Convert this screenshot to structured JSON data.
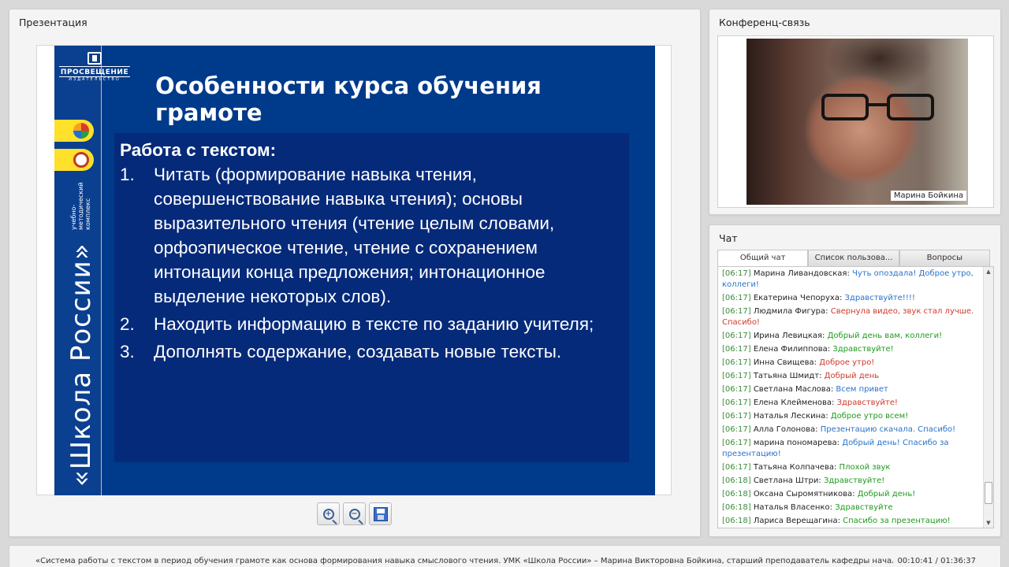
{
  "presentation": {
    "title": "Презентация",
    "slide": {
      "logo_text": "ПРОСВЕЩЕНИЕ",
      "logo_sub": "ИЗДАТЕЛЬСТВО",
      "side_big": "«Школа России»",
      "side_small": "учебно-методический комплекс",
      "title": "Особенности курса обучения грамоте",
      "heading": "Работа с текстом:",
      "items": [
        {
          "num": "1.",
          "text": "Читать (формирование навыка чтения, совершенствование навыка чтения); основы выразительного чтения (чтение целым словами, орфоэпическое чтение, чтение с сохранением интонации конца предложения; интонационное выделение некоторых слов)."
        },
        {
          "num": "2.",
          "text": "Находить информацию в тексте по заданию учителя;"
        },
        {
          "num": "3.",
          "text": "Дополнять содержание,  создавать новые тексты."
        }
      ]
    },
    "toolbar": {
      "zoom_in_icon": "zoom-in-icon",
      "zoom_out_icon": "zoom-out-icon",
      "save_icon": "save-icon"
    }
  },
  "conference": {
    "title": "Конференц-связь",
    "video_label": "Марина Бойкина"
  },
  "chat": {
    "title": "Чат",
    "tabs": [
      "Общий чат",
      "Список пользова...",
      "Вопросы"
    ],
    "messages": [
      {
        "time": "[06:17]",
        "author": "Марина Ливандовская:",
        "text": "Чуть опоздала! Доброе утро, коллеги!",
        "color": "blue"
      },
      {
        "time": "[06:17]",
        "author": "Екатерина Чепоруха:",
        "text": "Здравствуйте!!!!",
        "color": "blue"
      },
      {
        "time": "[06:17]",
        "author": "Людмила Фигура:",
        "text": "Свернула видео, звук стал лучше. Спасибо!",
        "color": "red"
      },
      {
        "time": "[06:17]",
        "author": "Ирина Левицкая:",
        "text": "Добрый день вам, коллеги!",
        "color": "green"
      },
      {
        "time": "[06:17]",
        "author": "Елена Филиппова:",
        "text": "Здравствуйте!",
        "color": "green"
      },
      {
        "time": "[06:17]",
        "author": "Инна Свищева:",
        "text": "Доброе утро!",
        "color": "red"
      },
      {
        "time": "[06:17]",
        "author": "Татьяна Шмидт:",
        "text": "Добрый день",
        "color": "red"
      },
      {
        "time": "[06:17]",
        "author": "Светлана Маслова:",
        "text": "Всем привет",
        "color": "blue"
      },
      {
        "time": "[06:17]",
        "author": "Елена Клейменова:",
        "text": "Здравствуйте!",
        "color": "red"
      },
      {
        "time": "[06:17]",
        "author": "Наталья Лескина:",
        "text": "Доброе утро всем!",
        "color": "green"
      },
      {
        "time": "[06:17]",
        "author": "Алла Голонова:",
        "text": "Презентацию скачала. Спасибо!",
        "color": "blue"
      },
      {
        "time": "[06:17]",
        "author": "марина пономарева:",
        "text": "Добрый день! Спасибо за презентацию!",
        "color": "blue"
      },
      {
        "time": "[06:17]",
        "author": "Татьяна Колпачева:",
        "text": "Плохой звук",
        "color": "green"
      },
      {
        "time": "[06:18]",
        "author": "Светлана Штри:",
        "text": "Здравствуйте!",
        "color": "green"
      },
      {
        "time": "[06:18]",
        "author": "Оксана Сыромятникова:",
        "text": "Добрый день!",
        "color": "green"
      },
      {
        "time": "[06:18]",
        "author": "Наталья Власенко:",
        "text": "Здравствуйте",
        "color": "green"
      },
      {
        "time": "[06:18]",
        "author": "Лариса Верещагина:",
        "text": "Спасибо за презентацию!",
        "color": "green"
      }
    ]
  },
  "footer": {
    "ticker": "«Система работы с текстом в период обучения грамоте как основа формирования навыка смыслового чтения. УМК «Школа России» – Марина Викторовна Бойкина, старший преподаватель кафедры начального образования С",
    "timecode": "00:10:41 / 01:36:37"
  },
  "colors": {
    "slide_bg": "#003a8a",
    "slide_box": "#062a7a",
    "accent_yellow": "#ffe02a",
    "chat_green": "#1f9a1f",
    "chat_blue": "#2a73c8",
    "chat_red": "#d0392b"
  }
}
